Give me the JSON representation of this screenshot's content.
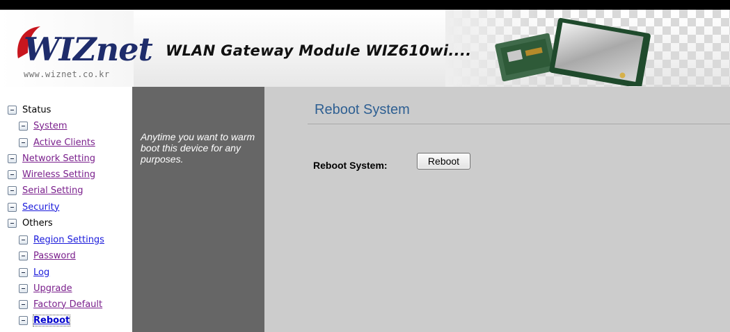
{
  "header": {
    "logo_text": "WIZnet",
    "logo_url": "www.wiznet.co.kr",
    "title": "WLAN Gateway Module WIZ610wi...."
  },
  "sidebar": {
    "items": [
      {
        "label": "Status",
        "style": "plain"
      },
      {
        "label": "System",
        "style": "visited"
      },
      {
        "label": "Active Clients",
        "style": "visited"
      },
      {
        "label": "Network Setting",
        "style": "visited"
      },
      {
        "label": "Wireless Setting",
        "style": "visited"
      },
      {
        "label": "Serial Setting",
        "style": "visited"
      },
      {
        "label": "Security",
        "style": "link"
      },
      {
        "label": "Others",
        "style": "plain"
      },
      {
        "label": "Region Settings",
        "style": "link"
      },
      {
        "label": "Password",
        "style": "visited"
      },
      {
        "label": "Log",
        "style": "link"
      },
      {
        "label": "Upgrade",
        "style": "visited"
      },
      {
        "label": "Factory Default",
        "style": "visited"
      },
      {
        "label": "Reboot",
        "style": "active"
      }
    ]
  },
  "help": {
    "text": "Anytime you want to warm boot this device for any purposes."
  },
  "main": {
    "title": "Reboot System",
    "reboot_label": "Reboot System:",
    "reboot_button": "Reboot"
  },
  "colors": {
    "help_bg": "#666666",
    "main_bg": "#cccccc",
    "title_blue": "#2e5f92",
    "visited_link": "#7a1f8c",
    "active_link": "#0000cc",
    "logo_red": "#c8161e",
    "logo_navy": "#1e2c6b"
  },
  "icons": {
    "sidebar_node": "collapse-minus-icon",
    "logo_mark": "wiznet-swoosh-icon",
    "module_image": "wlan-module-icon"
  }
}
